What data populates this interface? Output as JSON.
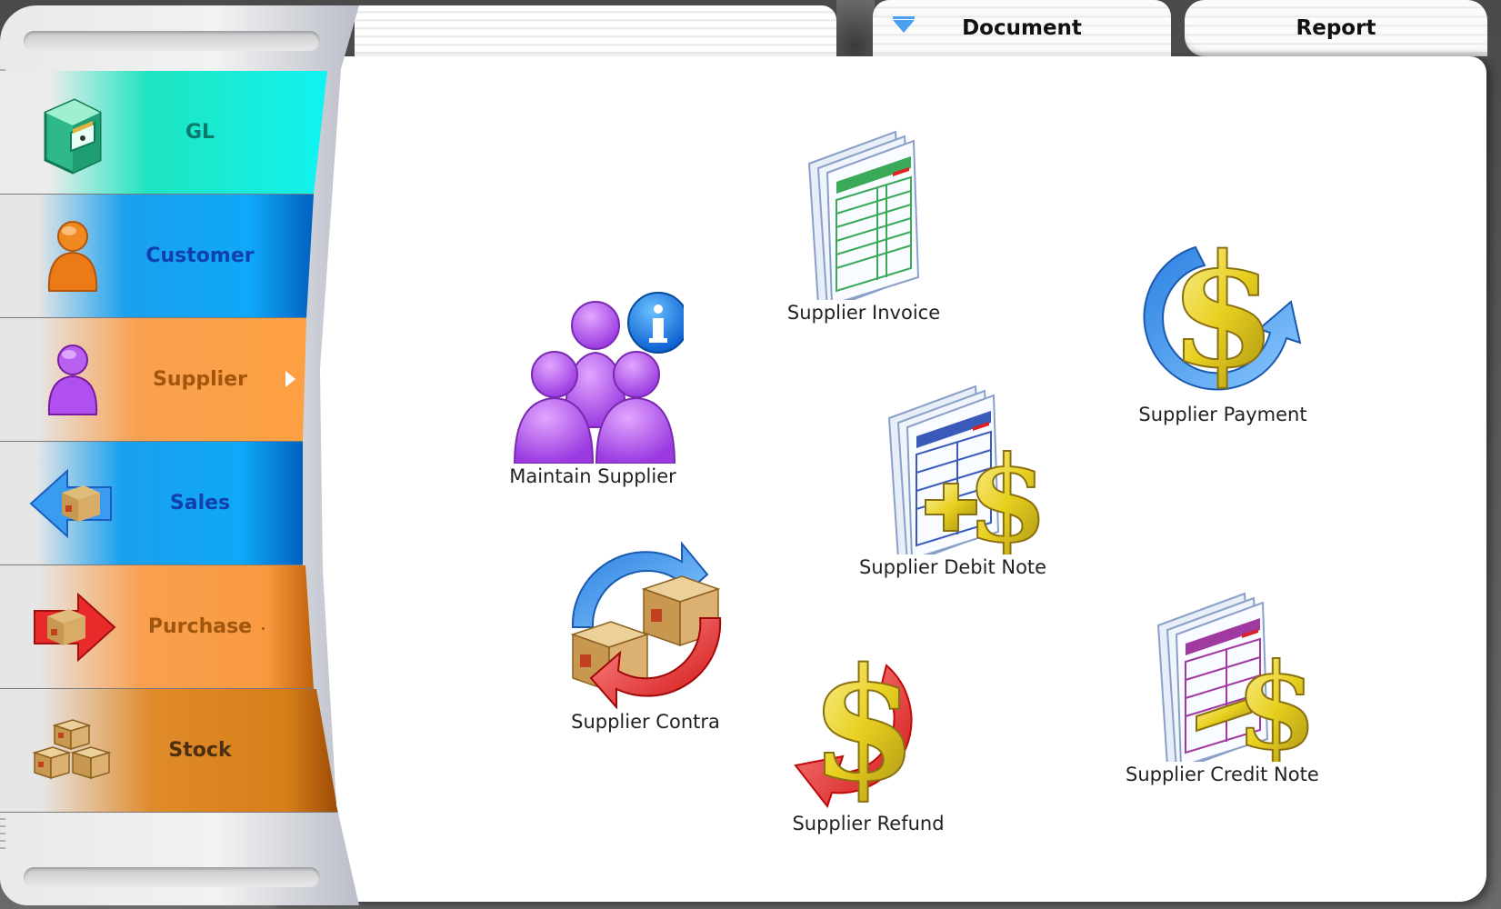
{
  "tabs": [
    {
      "label": "Document",
      "active": true,
      "icon": "filter-arrow-icon"
    },
    {
      "label": "Report",
      "active": false
    }
  ],
  "sidebar": {
    "items": [
      {
        "label": "GL",
        "icon": "filing-cabinet-icon",
        "color": "#14f0e6",
        "text_color": "#0a7a6c"
      },
      {
        "label": "Customer",
        "icon": "orange-person-icon",
        "color": "#10a8f8",
        "text_color": "#1040b0"
      },
      {
        "label": "Supplier",
        "icon": "purple-person-icon",
        "color": "#fda044",
        "text_color": "#a0560c",
        "selected": true
      },
      {
        "label": "Sales",
        "icon": "box-left-arrow-icon",
        "color": "#10a8f8",
        "text_color": "#1040b0"
      },
      {
        "label": "Purchase",
        "icon": "box-right-arrow-icon",
        "color": "#f99a40",
        "text_color": "#a0560c"
      },
      {
        "label": "Stock",
        "icon": "stacked-boxes-icon",
        "color": "#d67e18",
        "text_color": "#4a3010"
      }
    ]
  },
  "actions": [
    {
      "label": "Maintain Supplier",
      "icon": "supplier-group-info-icon"
    },
    {
      "label": "Supplier Invoice",
      "icon": "invoice-document-icon"
    },
    {
      "label": "Supplier Payment",
      "icon": "dollar-blue-arrow-icon"
    },
    {
      "label": "Supplier Debit Note",
      "icon": "document-plus-dollar-icon"
    },
    {
      "label": "Supplier Contra",
      "icon": "boxes-exchange-icon"
    },
    {
      "label": "Supplier Refund",
      "icon": "dollar-red-arrow-icon"
    },
    {
      "label": "Supplier Credit Note",
      "icon": "document-minus-dollar-icon"
    }
  ]
}
